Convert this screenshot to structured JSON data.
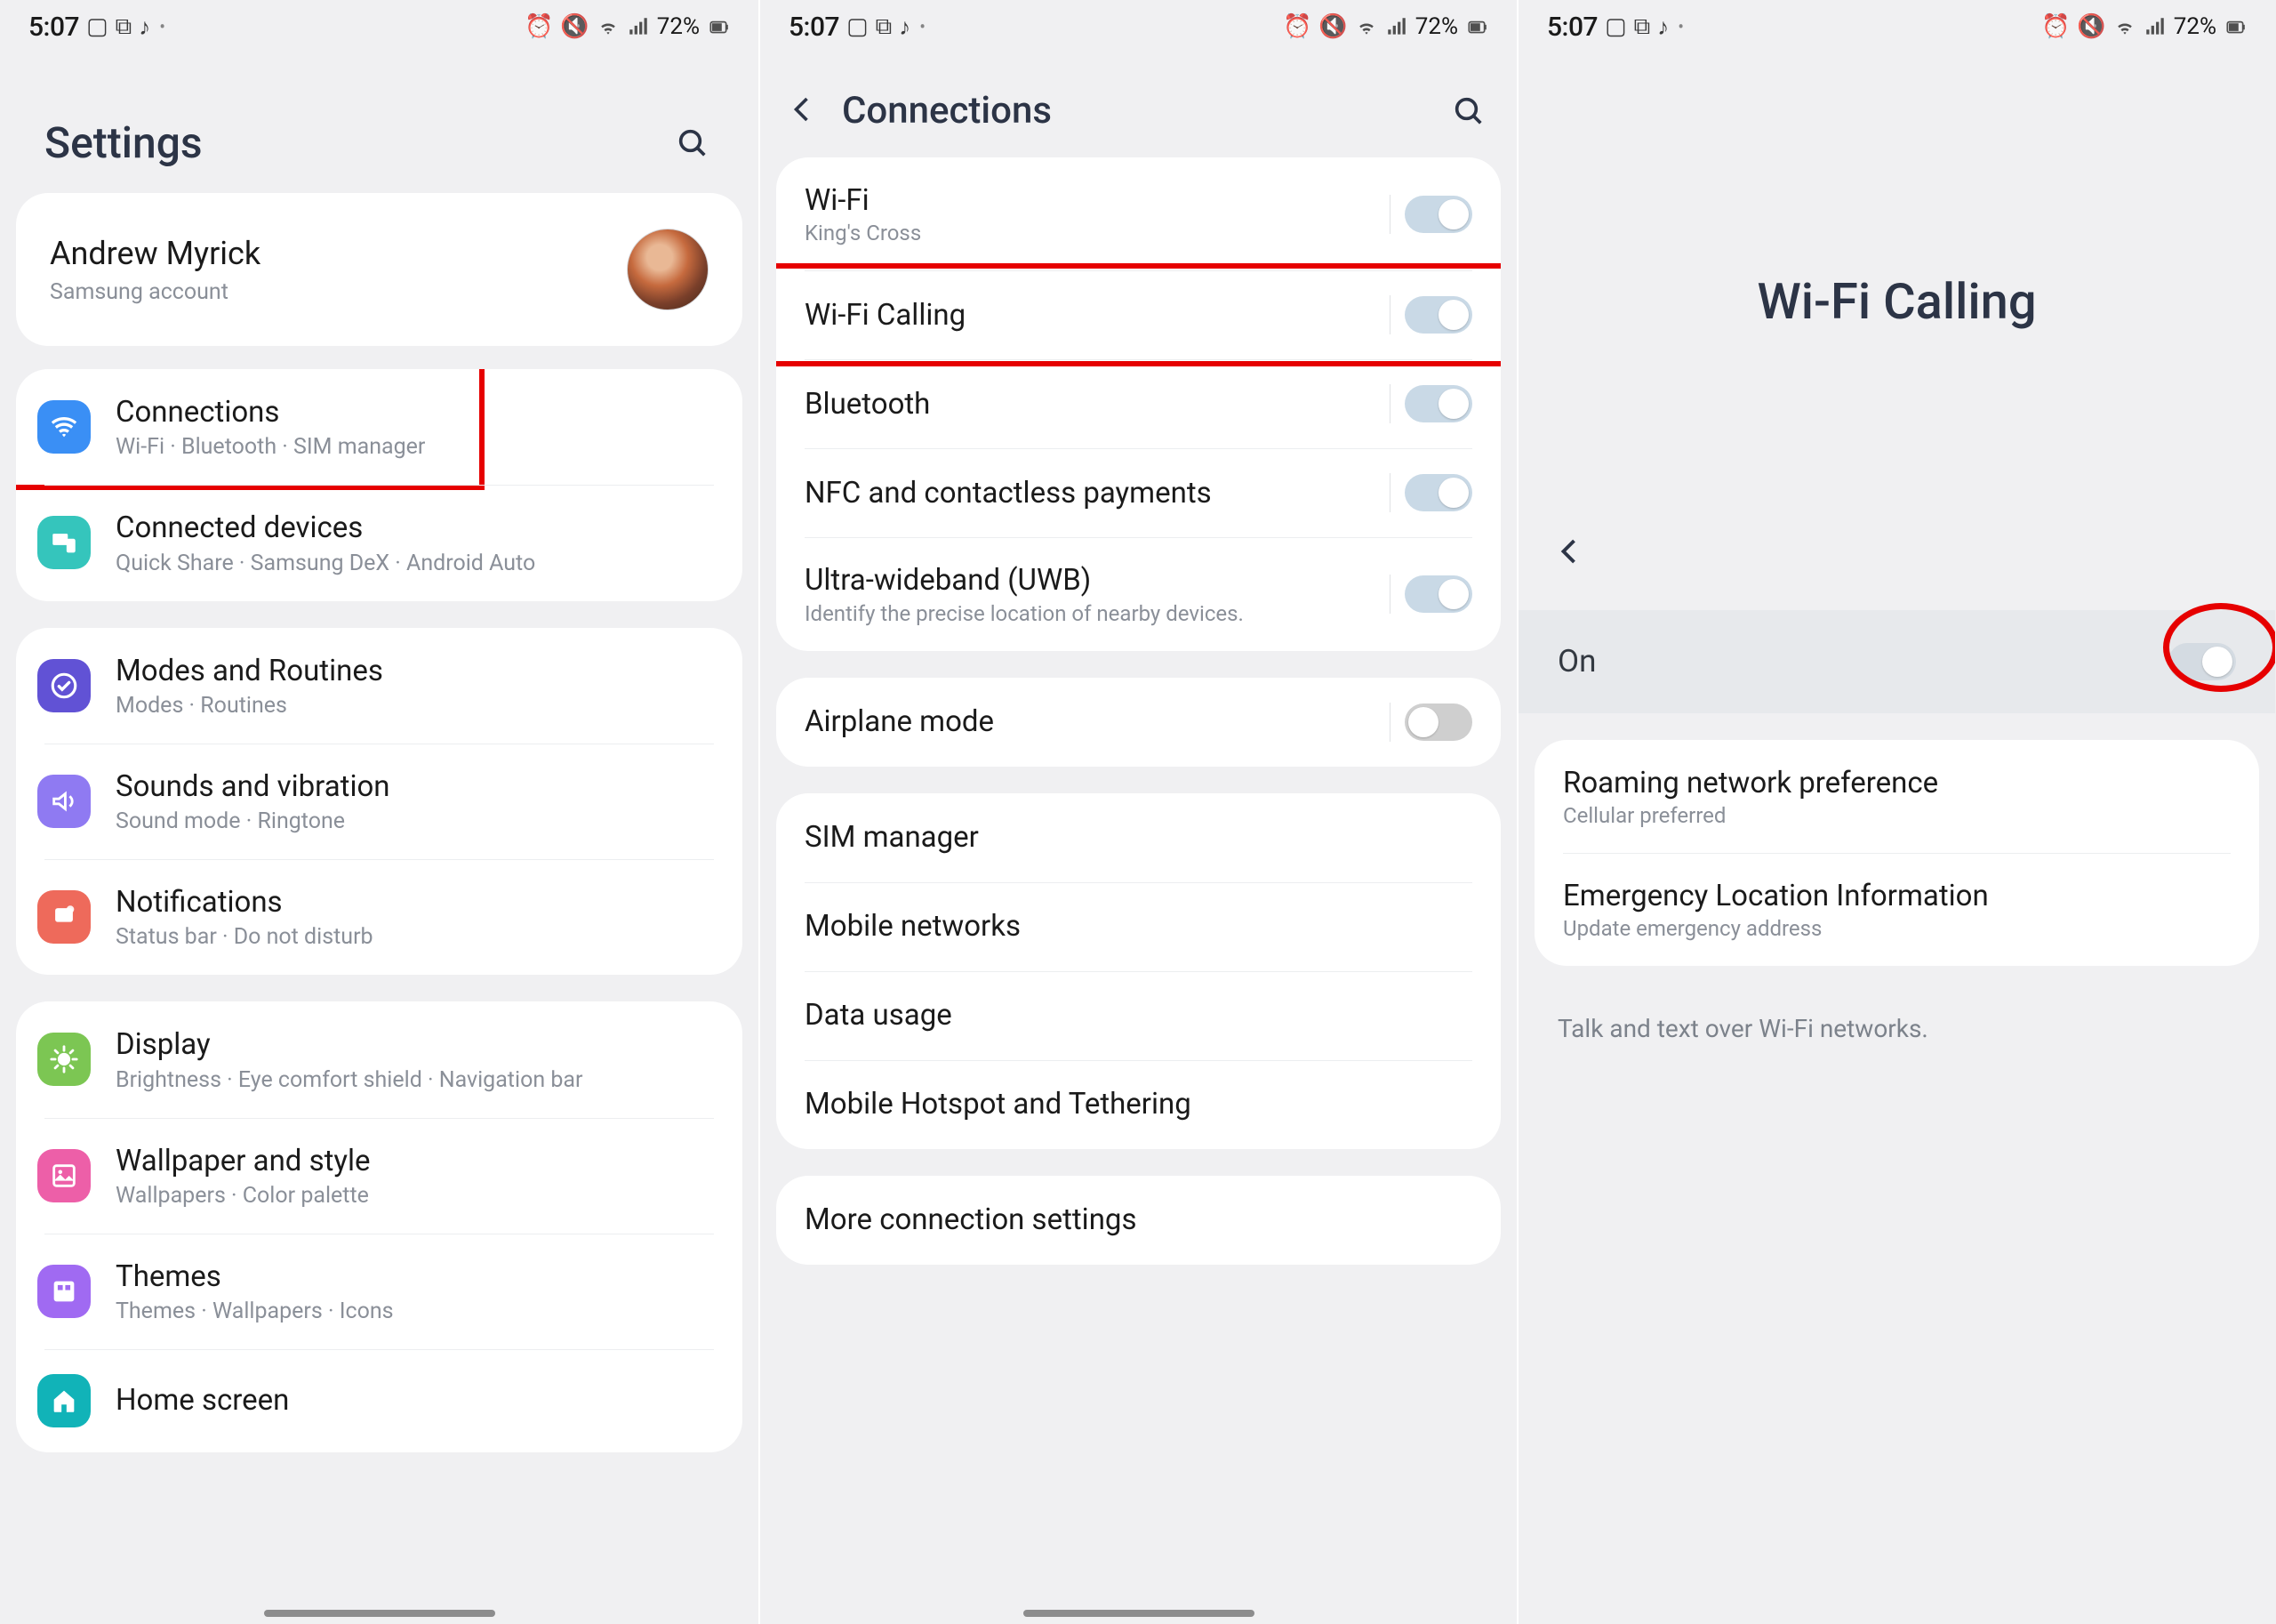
{
  "status": {
    "time": "5:07",
    "battery": "72%"
  },
  "screen1": {
    "header": "Settings",
    "account": {
      "name": "Andrew Myrick",
      "sub": "Samsung account"
    },
    "groups": [
      {
        "items": [
          {
            "key": "connections",
            "title": "Connections",
            "sub": "Wi-Fi · Bluetooth · SIM manager",
            "iconcls": "ic-blue",
            "hl": true
          },
          {
            "key": "connected-devices",
            "title": "Connected devices",
            "sub": "Quick Share · Samsung DeX · Android Auto",
            "iconcls": "ic-teal"
          }
        ]
      },
      {
        "items": [
          {
            "key": "modes",
            "title": "Modes and Routines",
            "sub": "Modes · Routines",
            "iconcls": "ic-purplecheck"
          },
          {
            "key": "sounds",
            "title": "Sounds and vibration",
            "sub": "Sound mode · Ringtone",
            "iconcls": "ic-lavender"
          },
          {
            "key": "notifications",
            "title": "Notifications",
            "sub": "Status bar · Do not disturb",
            "iconcls": "ic-coral"
          }
        ]
      },
      {
        "items": [
          {
            "key": "display",
            "title": "Display",
            "sub": "Brightness · Eye comfort shield · Navigation bar",
            "iconcls": "ic-green"
          },
          {
            "key": "wallpaper",
            "title": "Wallpaper and style",
            "sub": "Wallpapers · Color palette",
            "iconcls": "ic-pink"
          },
          {
            "key": "themes",
            "title": "Themes",
            "sub": "Themes · Wallpapers · Icons",
            "iconcls": "ic-violet"
          },
          {
            "key": "home",
            "title": "Home screen",
            "sub": "",
            "iconcls": "ic-tealhome"
          }
        ]
      }
    ]
  },
  "screen2": {
    "header": "Connections",
    "group1": [
      {
        "key": "wifi",
        "title": "Wi-Fi",
        "sub": "King's Cross",
        "toggle": "on"
      },
      {
        "key": "wifi-calling",
        "title": "Wi-Fi Calling",
        "toggle": "on",
        "hl": true
      },
      {
        "key": "bluetooth",
        "title": "Bluetooth",
        "toggle": "on"
      },
      {
        "key": "nfc",
        "title": "NFC and contactless payments",
        "toggle": "on"
      },
      {
        "key": "uwb",
        "title": "Ultra-wideband (UWB)",
        "sub": "Identify the precise location of nearby devices.",
        "toggle": "on"
      }
    ],
    "group2": [
      {
        "key": "airplane",
        "title": "Airplane mode",
        "toggle": "off"
      }
    ],
    "group3": [
      {
        "key": "sim",
        "title": "SIM manager"
      },
      {
        "key": "mobile",
        "title": "Mobile networks"
      },
      {
        "key": "data",
        "title": "Data usage"
      },
      {
        "key": "hotspot",
        "title": "Mobile Hotspot and Tethering"
      }
    ],
    "group4": [
      {
        "key": "more",
        "title": "More connection settings"
      }
    ]
  },
  "screen3": {
    "header": "Wi-Fi Calling",
    "master": {
      "label": "On",
      "state": "on-stale"
    },
    "rows": [
      {
        "key": "roaming",
        "title": "Roaming network preference",
        "sub": "Cellular preferred"
      },
      {
        "key": "e911",
        "title": "Emergency Location Information",
        "sub": "Update emergency address"
      }
    ],
    "hint": "Talk and text over Wi-Fi networks."
  }
}
